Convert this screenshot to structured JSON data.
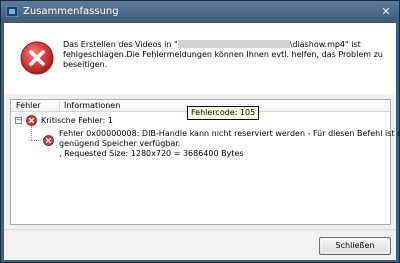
{
  "window": {
    "title": "Zusammenfassung",
    "close_glyph": "✕",
    "app_icon": "film-icon"
  },
  "message": {
    "icon": "error-icon",
    "line1_prefix": "Das Erstellen des Videos in \"",
    "line1_suffix": "\\diashow.mp4\" ist",
    "line2": "fehlgeschlagen.Die Fehlermeldungen können Ihnen evtl. helfen, das Problem zu",
    "line3": "beseitigen."
  },
  "log": {
    "columns": [
      "Fehler",
      "Informationen"
    ],
    "expander_glyph": "−",
    "group_label": "Kritische Fehler: 1",
    "details": [
      "Fehler 0x00000008: DIB-Handle kann nicht reserviert werden - Für diesen Befehl ist nicht",
      "genügend Speicher verfügbar.",
      ", Requested Size: 1280x720 = 3686400 Bytes"
    ]
  },
  "tooltip": {
    "text": "Fehlercode: 105"
  },
  "footer": {
    "close_label": "Schließen"
  },
  "colors": {
    "error_red": "#d32f2f",
    "titlebar": "#4a6a89",
    "tooltip_bg": "#ffffe1"
  }
}
